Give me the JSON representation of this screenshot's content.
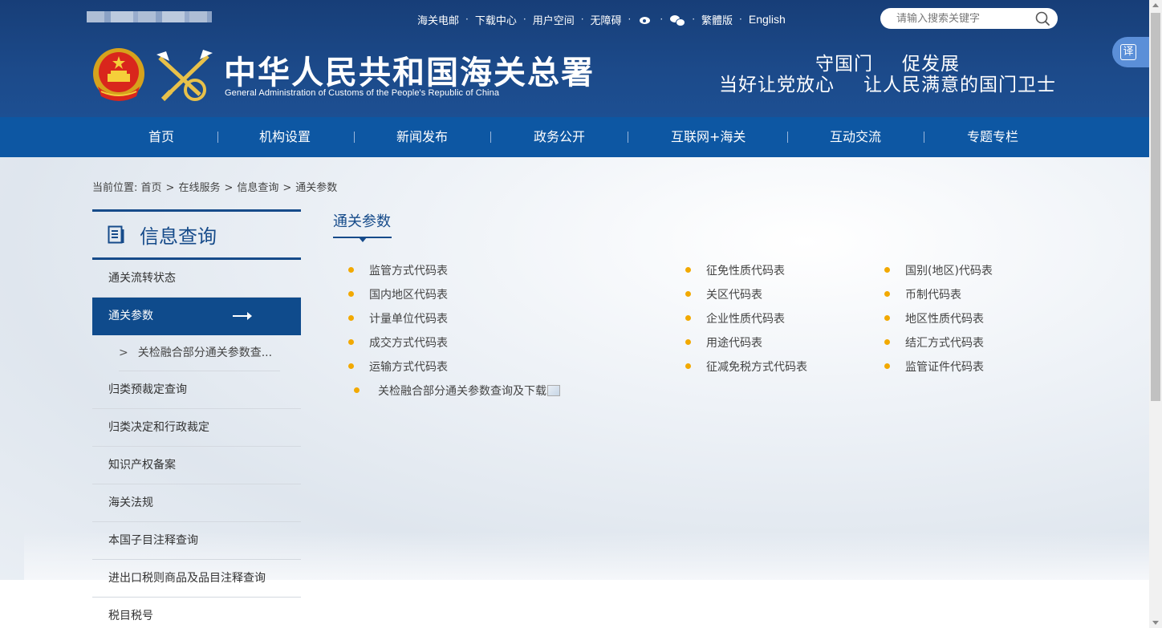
{
  "header": {
    "top_links": [
      "海关电邮",
      "下载中心",
      "用户空间",
      "无障碍"
    ],
    "icon_links": [
      {
        "name": "weibo-icon"
      },
      {
        "name": "wechat-icon"
      }
    ],
    "lang_links": [
      "繁體版",
      "English"
    ],
    "search": {
      "placeholder": "请输入搜索关键字"
    },
    "title": "中华人民共和国海关总署",
    "subtitle": "General Administration of Customs of the People's Republic of China",
    "slogan_line1": [
      "守国门",
      "促发展"
    ],
    "slogan_line2": [
      "当好让党放心",
      "让人民满意的国门卫士"
    ],
    "translate_label": "译"
  },
  "nav": {
    "items": [
      "首页",
      "机构设置",
      "新闻发布",
      "政务公开",
      "互联网+海关",
      "互动交流",
      "专题专栏"
    ]
  },
  "breadcrumb": {
    "prefix": "当前位置:",
    "items": [
      "首页",
      "在线服务",
      "信息查询",
      "通关参数"
    ],
    "separator": ">"
  },
  "sidebar": {
    "title": "信息查询",
    "items": [
      {
        "label": "通关流转状态"
      },
      {
        "label": "通关参数",
        "active": true
      },
      {
        "label": "关检融合部分通关参数查...",
        "sub": true
      },
      {
        "label": "归类预裁定查询"
      },
      {
        "label": "归类决定和行政裁定"
      },
      {
        "label": "知识产权备案"
      },
      {
        "label": "海关法规"
      },
      {
        "label": "本国子目注释查询"
      },
      {
        "label": "进出口税则商品及品目注释查询"
      },
      {
        "label": "税目税号"
      }
    ]
  },
  "main": {
    "title": "通关参数",
    "col1": [
      "监管方式代码表",
      "国内地区代码表",
      "计量单位代码表",
      "成交方式代码表",
      "运输方式代码表"
    ],
    "col2": [
      "征免性质代码表",
      "关区代码表",
      "企业性质代码表",
      "用途代码表",
      "征减免税方式代码表"
    ],
    "col3": [
      "国别(地区)代码表",
      "币制代码表",
      "地区性质代码表",
      "结汇方式代码表",
      "监管证件代码表"
    ],
    "extra_link": "关检融合部分通关参数查询及下载"
  },
  "colors": {
    "header_bg": "#1c4a8a",
    "nav_bg": "#0d57a3",
    "sidebar_active": "#0f4b8c",
    "accent_bullet": "#f2a900",
    "title_text": "#164b8a"
  }
}
